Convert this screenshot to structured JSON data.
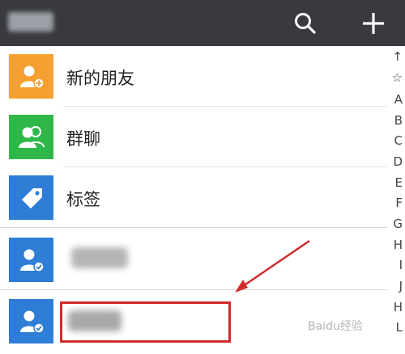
{
  "header": {
    "bg_color": "#393a3f",
    "search_icon": "search-icon",
    "add_icon": "plus-icon"
  },
  "contacts": {
    "rows": [
      {
        "label": "新的朋友",
        "icon": "add-person-icon",
        "color": "#f5a030"
      },
      {
        "label": "群聊",
        "icon": "group-icon",
        "color": "#2fb849"
      },
      {
        "label": "标签",
        "icon": "tag-icon",
        "color": "#2e7dd6"
      }
    ],
    "blurred_row_icon_color": "#2e7dd6"
  },
  "alphabet_index": [
    "↑",
    "☆",
    "A",
    "B",
    "C",
    "D",
    "E",
    "F",
    "G",
    "H",
    "I",
    "J",
    "H",
    "L"
  ],
  "annotation": {
    "highlight_color": "#d12a2a"
  },
  "watermark": "Baidu经验"
}
